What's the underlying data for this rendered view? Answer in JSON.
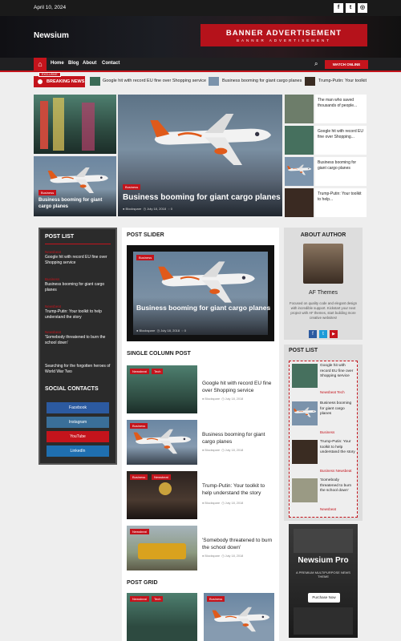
{
  "topbar": {
    "date": "April 10, 2024",
    "social": [
      "f",
      "t",
      "◎"
    ]
  },
  "header": {
    "brand": "Newsium",
    "banner_title": "BANNER ADVERTISEMENT",
    "banner_sub": "BANNER ADVERTISEMENT"
  },
  "nav": {
    "items": [
      "Home",
      "Blog",
      "About",
      "Contact"
    ],
    "watch": "WATCH ONLINE"
  },
  "ticker": {
    "label": "BREAKING NEWS",
    "badge": "EXCLUSIVE",
    "items": [
      "Google hit with record EU fine over Shopping service",
      "Business booming for giant cargo planes",
      "Trump-Putin: Your toolkit"
    ]
  },
  "hero": {
    "small_cat": "Business",
    "small_title": "Business booming for giant cargo planes",
    "main_cat": "Business",
    "main_title": "Business booming for giant cargo planes",
    "main_author": "Blockspare",
    "main_date": "July 18, 2018",
    "main_comments": "0"
  },
  "side_posts": [
    "The man who saved thousands of people...",
    "Google hit with record EU fine over Shopping...",
    "Business booming for giant cargo planes",
    "Trump-Putin: Your toolkit to help..."
  ],
  "post_list": {
    "title": "POST LIST",
    "items": [
      {
        "cat": "Newsbeat",
        "title": "Google hit with record EU fine over Shopping service"
      },
      {
        "cat": "Business",
        "title": "Business booming for giant cargo planes"
      },
      {
        "cat": "Newsbeat",
        "title": "Trump-Putin: Your toolkit to help understand the story"
      },
      {
        "cat": "Newsbeat",
        "title": "'Somebody threatened to burn the school down'"
      },
      {
        "cat": "",
        "title": "Searching for the forgotten heroes of World War Two"
      }
    ]
  },
  "social_contacts": {
    "title": "SOCIAL CONTACTS",
    "buttons": [
      "Facebook",
      "Instagram",
      "YouTube",
      "LinkedIn"
    ]
  },
  "slider": {
    "title": "POST SLIDER",
    "cat": "Business",
    "post_title": "Business booming for giant cargo planes",
    "author": "Blockspare",
    "date": "July 18, 2018",
    "comments": "0"
  },
  "single": {
    "title": "SINGLE COLUMN POST",
    "posts": [
      {
        "cats": [
          "Newsbeat",
          "Tech"
        ],
        "title": "Google hit with record EU fine over Shopping service",
        "author": "Blockspare",
        "date": "July 18, 2018"
      },
      {
        "cats": [
          "Business"
        ],
        "title": "Business booming for giant cargo planes",
        "author": "Blockspare",
        "date": "July 18, 2018"
      },
      {
        "cats": [
          "Business",
          "Newsbeat"
        ],
        "title": "Trump-Putin: Your toolkit to help understand the story",
        "author": "Blockspare",
        "date": "July 18, 2018"
      },
      {
        "cats": [
          "Newsbeat"
        ],
        "title": "'Somebody threatened to burn the school down'",
        "author": "Blockspare",
        "date": "July 18, 2018"
      }
    ]
  },
  "grid": {
    "title": "POST GRID",
    "cats1": [
      "Newsbeat",
      "Tech"
    ],
    "cats2": [
      "Business"
    ]
  },
  "about": {
    "title": "ABOUT AUTHOR",
    "name": "AF Themes",
    "desc": "Focused on quality code and elegant design with incredible support. Kickstart your next project with AF themes, start building more creative websites!",
    "icons": [
      "f",
      "t",
      "▶"
    ]
  },
  "right_list": {
    "title": "POST LIST",
    "items": [
      {
        "title": "Google hit with record EU fine over Shopping service",
        "cats": "Newsbeat  Tech"
      },
      {
        "title": "Business booming for giant cargo planes",
        "cats": "Business"
      },
      {
        "title": "Trump-Putin: Your toolkit to help understand the story",
        "cats": "Business  Newsbeat"
      },
      {
        "title": "'Somebody threatened to burn the school down'",
        "cats": "Newsbeat"
      }
    ]
  },
  "promo": {
    "title": "Newsium Pro",
    "sub": "A PREMIUM MULTIPURPOSE NEWS THEME",
    "button": "Purchase Now"
  },
  "colors": {
    "accent": "#c4141c",
    "dark": "#1a1a1a"
  }
}
